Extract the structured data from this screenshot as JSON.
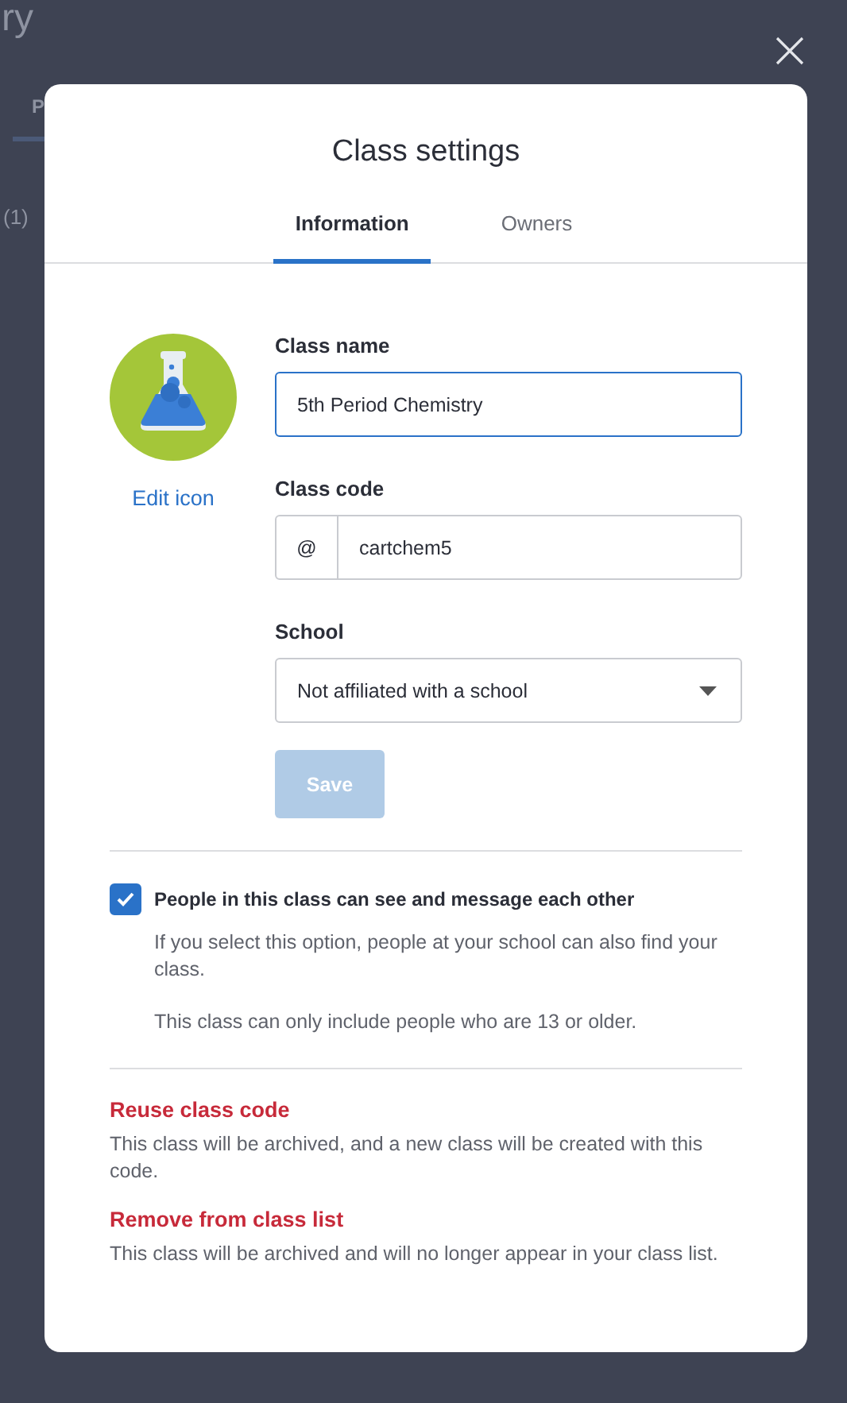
{
  "background": {
    "heading": "ry",
    "tab": "P",
    "count": "(1)"
  },
  "dialog": {
    "title": "Class settings",
    "tabs": [
      {
        "label": "Information",
        "selected": true
      },
      {
        "label": "Owners",
        "selected": false
      }
    ],
    "edit_icon_link": "Edit icon",
    "fields": [
      {
        "kind": "text",
        "label": "Class name",
        "value": "5th Period Chemistry",
        "focused": true
      },
      {
        "kind": "prefixed",
        "label": "Class code",
        "prefix": "@",
        "value": "cartchem5",
        "focused": false
      },
      {
        "kind": "select",
        "label": "School",
        "value": "Not affiliated with a school",
        "focused": false
      }
    ],
    "save_button": {
      "label": "Save",
      "disabled": true
    },
    "messaging": {
      "label": "People in this class can see and message each other",
      "checked": true,
      "notes": [
        "If you select this option, people at your school can also find your class.",
        "This class can only include people who are 13 or older."
      ]
    },
    "actions": [
      {
        "label": "Reuse class code",
        "description": "This class will be archived, and a new class will be created with this code."
      },
      {
        "label": "Remove from class list",
        "description": "This class will be archived and will no longer appear in your class list."
      }
    ]
  }
}
